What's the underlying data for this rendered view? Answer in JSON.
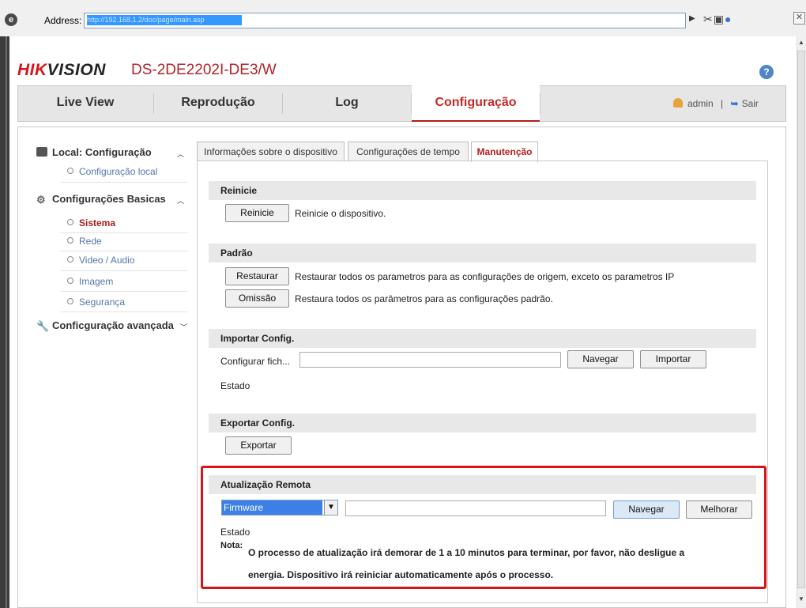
{
  "browser": {
    "address_label": "Address:",
    "address_url": "http://192.168.1.2/doc/page/main.asp"
  },
  "header": {
    "brand": "HIK",
    "brand_rest": "VISION",
    "model": "DS-2DE2202I-DE3/W",
    "help": "?"
  },
  "nav": {
    "tabs": [
      "Live View",
      "Reprodução",
      "Log",
      "Configuração"
    ],
    "active": "Configuração",
    "user": "admin",
    "separator": "|",
    "logout": "Sair"
  },
  "sidebar": {
    "local_head": "Local: Configuração",
    "local_items": [
      "Configuração local"
    ],
    "basic_head": "Configurações Basicas",
    "basic_items": [
      "Sistema",
      "Rede",
      "Video / Audio",
      "Imagem",
      "Segurança"
    ],
    "active_item": "Sistema",
    "advanced_head": "Conficguração avançada"
  },
  "subtabs": [
    "Informações sobre o dispositivo",
    "Configurações de tempo",
    "Manutenção"
  ],
  "active_subtab": "Manutenção",
  "sections": {
    "reboot": {
      "title": "Reinicie",
      "button": "Reinicie",
      "desc": "Reinicie o dispositivo."
    },
    "default": {
      "title": "Padrão",
      "restore_button": "Restaurar",
      "restore_desc": "Restaurar todos os parametros para as configurações de origem, exceto os parametros IP",
      "omit_button": "Omissão",
      "omit_desc": "Restaura todos os parâmetros para as configurações padrão."
    },
    "import": {
      "title": "Importar Config.",
      "file_label": "Configurar fich...",
      "file_value": "",
      "browse_button": "Navegar",
      "import_button": "Importar",
      "status_label": "Estado"
    },
    "export": {
      "title": "Exportar Config.",
      "button": "Exportar"
    },
    "upgrade": {
      "title": "Atualização Remota",
      "select_value": "Firmware",
      "file_value": "",
      "browse_button": "Navegar",
      "upgrade_button": "Melhorar",
      "status_label": "Estado",
      "note_label": "Nota:",
      "note_line1": "O processo de atualização irá demorar de 1 a 10 minutos para terminar, por favor, não desligue a",
      "note_line2": "energia. Dispositivo irá reiniciar automaticamente após o processo."
    }
  },
  "colors": {
    "accent": "#b71c1c",
    "highlight_border": "#d8141a",
    "link": "#5577aa",
    "section_bg": "#e8e8e8"
  }
}
